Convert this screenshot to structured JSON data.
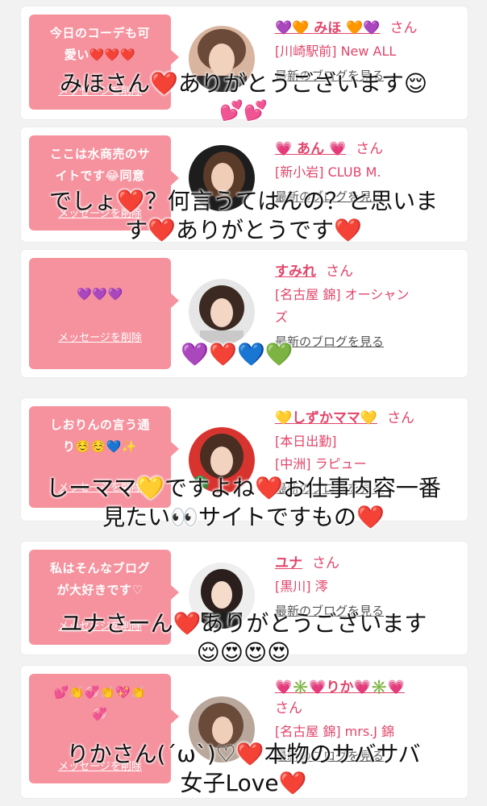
{
  "colors": {
    "accent": "#e2456a",
    "bubble": "#f5929e",
    "page_bg": "#f2f2f2",
    "card_bg": "#ffffff"
  },
  "cards": [
    {
      "message": "今日のコーデも可\n愛い❤️❤️❤️",
      "delete_label": "メッセージを削除",
      "name": "💜🧡 みほ 🧡💜",
      "honorific": "さん",
      "shop_lines": [
        "[川崎駅前] New ALL"
      ],
      "blog_label": "最新のブログを見る",
      "avatar_icon": "woman-portrait-icon"
    },
    {
      "message": "ここは水商売のサ\nイトです😂同意",
      "delete_label": "メッセージを削除",
      "name": "💗 あん 💗",
      "honorific": "さん",
      "shop_lines": [
        "[新小岩] CLUB M."
      ],
      "blog_label": "最新のブログを見る",
      "avatar_icon": "woman-portrait-icon"
    },
    {
      "message": "💜💜💜",
      "delete_label": "メッセージを削除",
      "name": "すみれ",
      "honorific": "さん",
      "shop_lines": [
        "[名古屋 錦] オーシャン",
        "ズ"
      ],
      "blog_label": "最新のブログを見る",
      "avatar_icon": "woman-portrait-icon"
    },
    {
      "message": "しおりんの言う通\nり☺️☺️💙✨",
      "delete_label": "メッセージを削除",
      "name": "💛しずかママ💛",
      "honorific": "さん",
      "shop_lines": [
        "[本日出勤]",
        "[中洲] ラピュー"
      ],
      "blog_label": "最新のブログを見る",
      "avatar_icon": "woman-portrait-icon"
    },
    {
      "message": "私はそんなブログ\nが大好きです♡",
      "delete_label": "メッセージを削除",
      "name": "ユナ",
      "honorific": "さん",
      "shop_lines": [
        "[黒川] 澪"
      ],
      "blog_label": "最新のブログを見る",
      "avatar_icon": "woman-portrait-icon"
    },
    {
      "message": "💕👏💞👏💖👏\n💞",
      "delete_label": "メッセージを削除",
      "name": "💗✳️💗りか💗✳️💗",
      "honorific": "さん",
      "shop_lines": [
        "[名古屋 錦] mrs.J 錦"
      ],
      "blog_label": "最新のブログを見る",
      "avatar_icon": "woman-portrait-icon"
    }
  ],
  "overlays": [
    {
      "lines": [
        "みほさん❤️ありがとうございます😌",
        "💕💕"
      ]
    },
    {
      "lines": [
        "でしょ❤️？何言うてはんの？と思いま",
        "す❤️ありがとうです❤️"
      ]
    },
    {
      "lines": [
        "💜❤️💙💚"
      ]
    },
    {
      "lines": [
        "しーママ💛ですよね❤️お仕事内容一番",
        "見たい👀サイトですもの❤️"
      ]
    },
    {
      "lines": [
        "ユナさーん❤️ありがとうございます",
        "😌😍😍😍"
      ]
    },
    {
      "lines": [
        "りかさん(´ω`)♡❤️本物のサバサバ",
        "女子Love❤️"
      ]
    }
  ]
}
